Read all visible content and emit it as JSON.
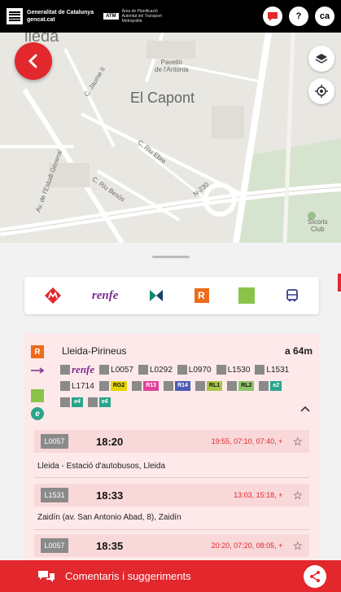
{
  "header": {
    "gen_line1": "Generalitat de Catalunya",
    "gen_line2": "gencat.cat",
    "atm_code": "ATM",
    "atm_text": "Àrea de Planificació Autoritat del Transport Metropolità",
    "help_label": "?",
    "lang_label": "ca"
  },
  "map": {
    "city_label": "Lleida",
    "district_label": "El Capont",
    "poi_line1": "Pavelló",
    "poi_line2": "de l'Antonia",
    "streets": [
      "C. Jaume II",
      "C. Riu Ebre",
      "C. Riu Besòs",
      "Av. de l'Estudi General",
      "N-230"
    ],
    "club_line1": "Sícoris",
    "club_line2": "Club",
    "edge_label": "lleda"
  },
  "modes": [
    {
      "icon": "metro-icon",
      "label": ""
    },
    {
      "icon": "renfe-logo",
      "label": "renfe"
    },
    {
      "icon": "fgc-icon",
      "label": ""
    },
    {
      "icon": "rodalies-icon",
      "label": "R"
    },
    {
      "icon": "bus-interurban-icon",
      "label": ""
    },
    {
      "icon": "bus-icon",
      "label": ""
    }
  ],
  "station": {
    "name": "Lleida-Pirineus",
    "distance": "a 64m",
    "renfe_label": "renfe",
    "lines": [
      "L0057",
      "L0292",
      "L0970",
      "L1530",
      "L1531",
      "L1714"
    ],
    "tags": [
      {
        "label": "RG2",
        "color": "#e6d400"
      },
      {
        "label": "R13",
        "color": "#e0419b"
      },
      {
        "label": "R14",
        "color": "#4c5cb6"
      },
      {
        "label": "RL1",
        "color": "#a8c64a"
      },
      {
        "label": "RL2",
        "color": "#8fc36b"
      },
      {
        "label": "e2",
        "color": "#2aa58b"
      },
      {
        "label": "e4",
        "color": "#2aa58b"
      },
      {
        "label": "e6",
        "color": "#2aa58b"
      }
    ]
  },
  "departures": [
    {
      "code": "L0057",
      "time": "18:20",
      "next": "19:55, 07:10, 07:40, +",
      "stop": "Lleida - Estació d'autobusos, Lleida"
    },
    {
      "code": "L1531",
      "time": "18:33",
      "next": "13:03, 15:18, +",
      "stop": "Zaidín (av. San Antonio Abad, 8), Zaidín"
    },
    {
      "code": "L0057",
      "time": "18:35",
      "next": "20:20, 07:20, 08:05, +",
      "stop": ""
    }
  ],
  "footer": {
    "label": "Comentaris i suggeriments"
  },
  "colors": {
    "accent": "#e2272d",
    "card_bg": "#fde9e9",
    "renfe": "#7a2b8e"
  }
}
